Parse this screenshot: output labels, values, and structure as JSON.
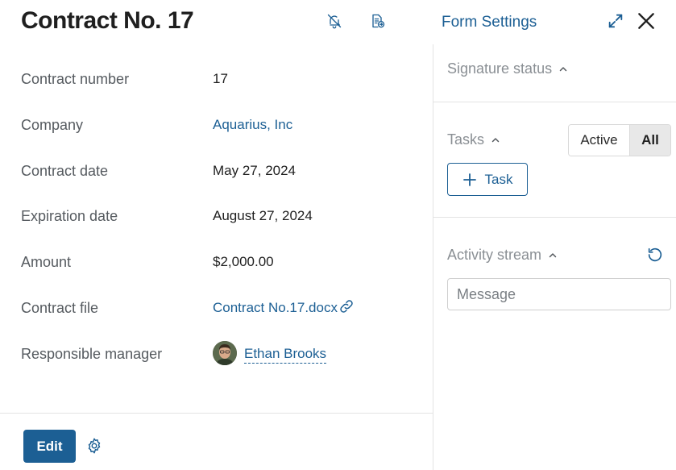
{
  "header": {
    "title": "Contract No. 17",
    "form_settings": "Form Settings",
    "icons": [
      "bell-off-icon",
      "document-send-icon",
      "expand-icon",
      "close-icon"
    ]
  },
  "fields": [
    {
      "label": "Contract number",
      "value": "17"
    },
    {
      "label": "Company",
      "value": "Aquarius, Inc"
    },
    {
      "label": "Contract date",
      "value": "May 27, 2024"
    },
    {
      "label": "Expiration date",
      "value": "August 27, 2024"
    },
    {
      "label": "Amount",
      "value": "$2,000.00"
    },
    {
      "label": "Contract file",
      "value": "Contract No.17.docx"
    },
    {
      "label": "Responsible manager",
      "value": "Ethan Brooks"
    }
  ],
  "footer": {
    "edit_label": "Edit"
  },
  "right_panel": {
    "signature_status": "Signature status",
    "tasks": "Tasks",
    "filter_active": "Active",
    "filter_all": "All",
    "add_task_label": "Task",
    "activity_stream": "Activity stream",
    "message_placeholder": "Message"
  },
  "colors": {
    "accent": "#1c5f94",
    "label": "#555a5f",
    "muted": "#8a8f94",
    "divider": "#e3e3e3"
  }
}
